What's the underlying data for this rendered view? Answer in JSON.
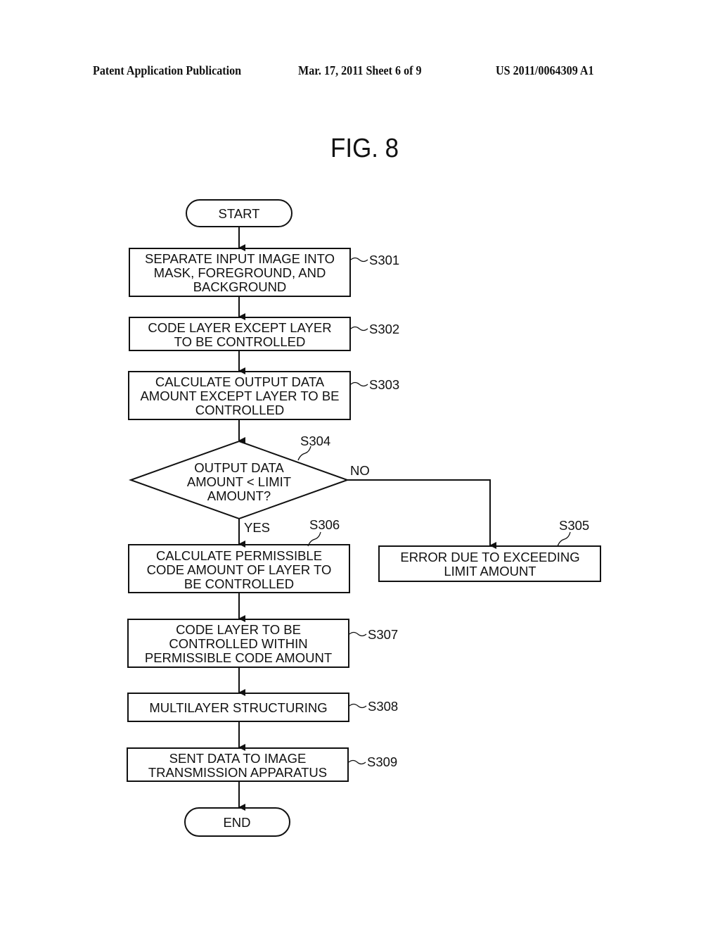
{
  "header": {
    "publication": "Patent Application Publication",
    "date_sheet": "Mar. 17, 2011  Sheet 6 of 9",
    "patent_number": "US 2011/0064309 A1"
  },
  "figure": {
    "title": "FIG. 8"
  },
  "flowchart": {
    "start": "START",
    "end": "END",
    "steps": [
      {
        "id": "S301",
        "lines": [
          "SEPARATE INPUT IMAGE INTO",
          "MASK, FOREGROUND, AND",
          "BACKGROUND"
        ]
      },
      {
        "id": "S302",
        "lines": [
          "CODE LAYER EXCEPT LAYER",
          "TO BE CONTROLLED"
        ]
      },
      {
        "id": "S303",
        "lines": [
          "CALCULATE OUTPUT DATA",
          "AMOUNT EXCEPT LAYER TO BE",
          "CONTROLLED"
        ]
      },
      {
        "id": "S304",
        "lines": [
          "OUTPUT DATA",
          "AMOUNT < LIMIT",
          "AMOUNT?"
        ]
      },
      {
        "id": "S305",
        "lines": [
          "ERROR DUE TO EXCEEDING",
          "LIMIT AMOUNT"
        ]
      },
      {
        "id": "S306",
        "lines": [
          "CALCULATE PERMISSIBLE",
          "CODE AMOUNT OF LAYER TO",
          "BE CONTROLLED"
        ]
      },
      {
        "id": "S307",
        "lines": [
          "CODE LAYER TO BE",
          "CONTROLLED WITHIN",
          "PERMISSIBLE CODE AMOUNT"
        ]
      },
      {
        "id": "S308",
        "lines": [
          "MULTILAYER STRUCTURING"
        ]
      },
      {
        "id": "S309",
        "lines": [
          "SENT DATA TO IMAGE",
          "TRANSMISSION APPARATUS"
        ]
      }
    ],
    "branches": {
      "yes": "YES",
      "no": "NO"
    }
  }
}
